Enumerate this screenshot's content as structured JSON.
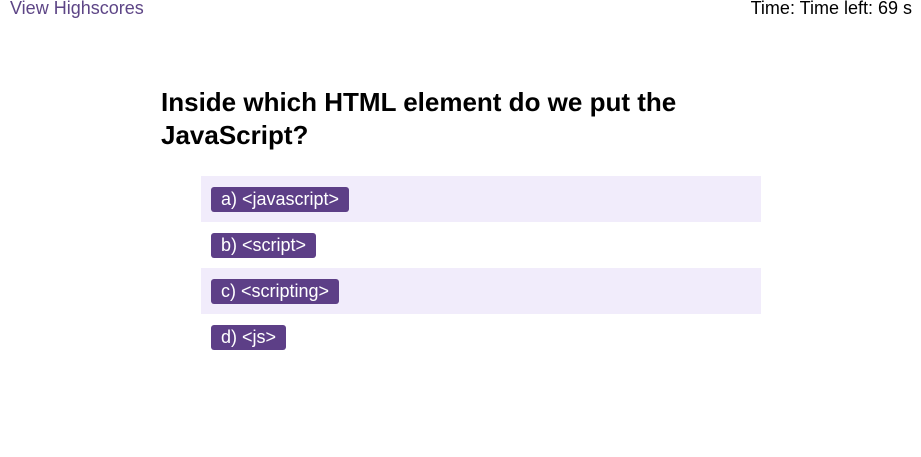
{
  "header": {
    "highscores_link": "View Highscores",
    "timer_text": "Time: Time left: 69 s"
  },
  "quiz": {
    "question": "Inside which HTML element do we put the JavaScript?",
    "choices": [
      {
        "label": "a) <javascript>"
      },
      {
        "label": "b) <script>"
      },
      {
        "label": "c) <scripting>"
      },
      {
        "label": "d) <js>"
      }
    ]
  },
  "colors": {
    "accent": "#5d3f87",
    "link": "#5d4586",
    "row_highlight": "#f1ecfb"
  }
}
